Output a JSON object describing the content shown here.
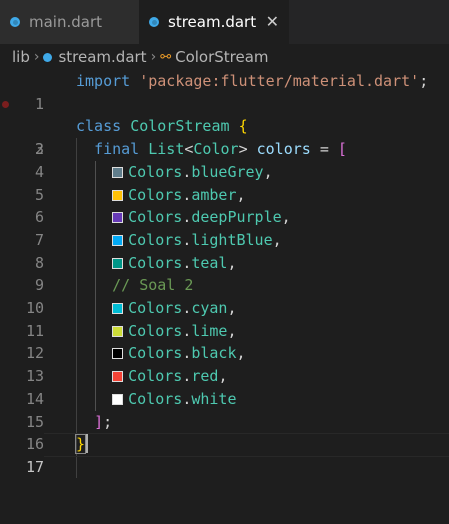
{
  "tabs": [
    {
      "label": "main.dart",
      "active": false,
      "icon": "dart-icon"
    },
    {
      "label": "stream.dart",
      "active": true,
      "icon": "dart-icon",
      "close": "✕"
    }
  ],
  "breadcrumb": {
    "folder": "lib",
    "file": "stream.dart",
    "symbol": "ColorStream"
  },
  "editor": {
    "active_line": 17,
    "lines": [
      {
        "n": "1"
      },
      {
        "n": "2"
      },
      {
        "n": "3"
      },
      {
        "n": "4"
      },
      {
        "n": "5"
      },
      {
        "n": "6"
      },
      {
        "n": "7"
      },
      {
        "n": "8"
      },
      {
        "n": "9"
      },
      {
        "n": "10"
      },
      {
        "n": "11"
      },
      {
        "n": "12"
      },
      {
        "n": "13"
      },
      {
        "n": "14"
      },
      {
        "n": "15"
      },
      {
        "n": "16"
      },
      {
        "n": "17"
      }
    ],
    "code": {
      "import_kw": "import",
      "import_str": "'package:flutter/material.dart'",
      "semicolon": ";",
      "class_kw": "class",
      "class_name": "ColorStream",
      "open_brace": "{",
      "final_kw": "final",
      "list_type": "List",
      "lt": "<",
      "color_type": "Color",
      "gt": ">",
      "field_name": "colors",
      "eq": "=",
      "open_bracket": "[",
      "comment": "// Soal 2",
      "close_bracket": "]",
      "close_semicolon": ";",
      "close_brace": "}"
    },
    "colors": [
      {
        "cls": "Colors",
        "member": "blueGrey",
        "sep": ",",
        "swatch": "#607d8b"
      },
      {
        "cls": "Colors",
        "member": "amber",
        "sep": ",",
        "swatch": "#ffc107"
      },
      {
        "cls": "Colors",
        "member": "deepPurple",
        "sep": ",",
        "swatch": "#673ab7"
      },
      {
        "cls": "Colors",
        "member": "lightBlue",
        "sep": ",",
        "swatch": "#03a9f4"
      },
      {
        "cls": "Colors",
        "member": "teal",
        "sep": ",",
        "swatch": "#009688"
      },
      {
        "cls": "Colors",
        "member": "cyan",
        "sep": ",",
        "swatch": "#00bcd4"
      },
      {
        "cls": "Colors",
        "member": "lime",
        "sep": ",",
        "swatch": "#cddc39"
      },
      {
        "cls": "Colors",
        "member": "black",
        "sep": ",",
        "swatch": "#000000"
      },
      {
        "cls": "Colors",
        "member": "red",
        "sep": ",",
        "swatch": "#f44336"
      },
      {
        "cls": "Colors",
        "member": "white",
        "sep": "",
        "swatch": "#ffffff"
      }
    ]
  }
}
